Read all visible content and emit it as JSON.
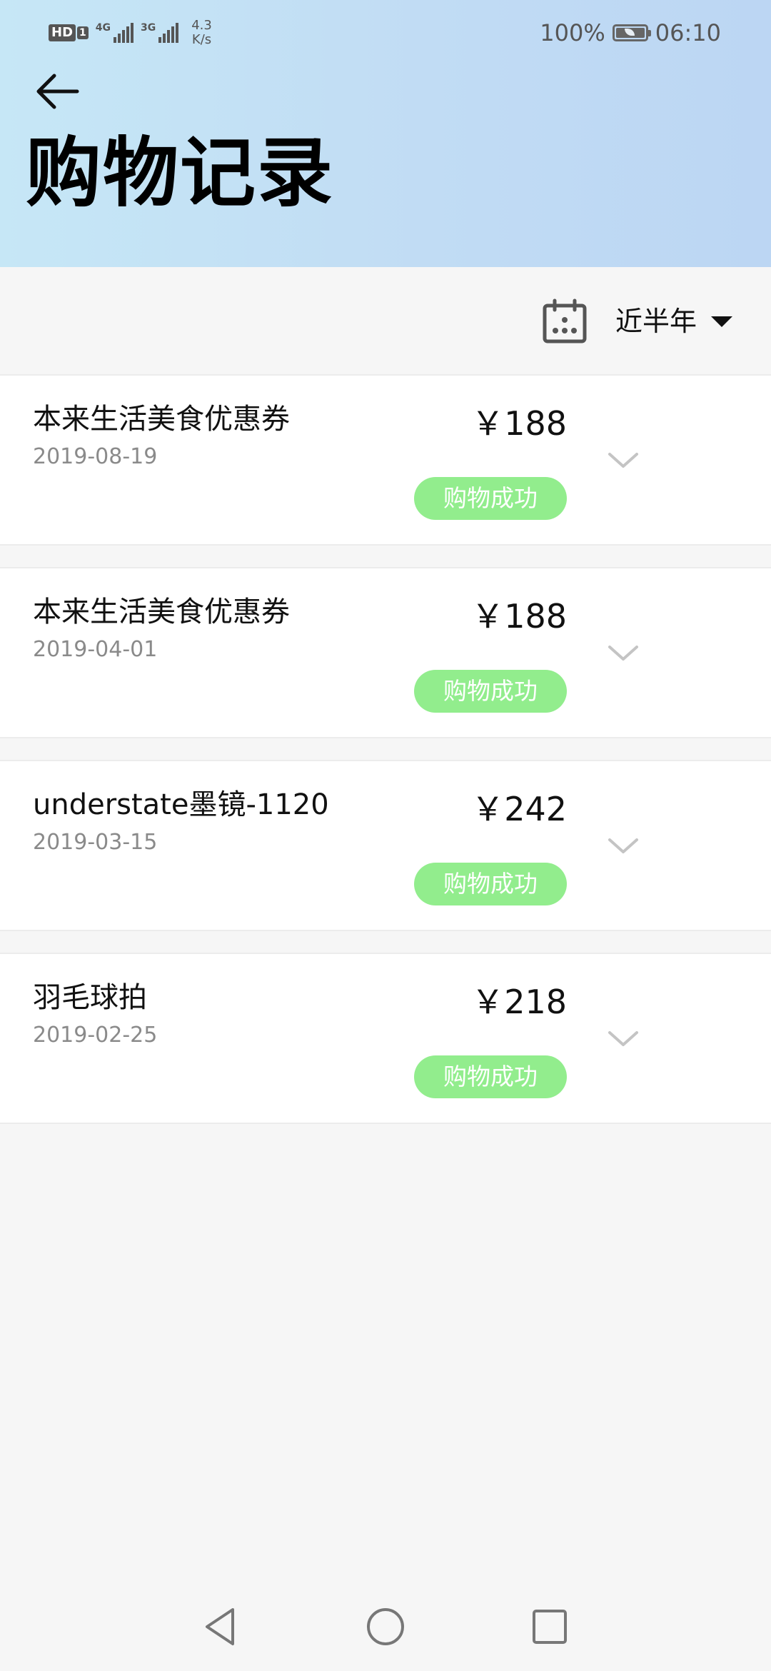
{
  "status_bar": {
    "hd_label": "HD",
    "sim_label": "1",
    "signal1_label": "4G",
    "signal2_label": "3G",
    "net_speed_value": "4.3",
    "net_speed_unit": "K/s",
    "battery_percent": "100%",
    "time": "06:10",
    "icons": [
      "hd-icon",
      "signal-4g-icon",
      "signal-3g-icon",
      "battery-icon"
    ]
  },
  "header": {
    "title": "购物记录",
    "back_icon": "arrow-left-icon"
  },
  "filter": {
    "calendar_icon": "calendar-icon",
    "period_label": "近半年",
    "dropdown_icon": "caret-down-icon"
  },
  "records": [
    {
      "name": "本来生活美食优惠券",
      "date": "2019-08-19",
      "price": "￥188",
      "status": "购物成功"
    },
    {
      "name": "本来生活美食优惠券",
      "date": "2019-04-01",
      "price": "￥188",
      "status": "购物成功"
    },
    {
      "name": "understate墨镜-1120",
      "date": "2019-03-15",
      "price": "￥242",
      "status": "购物成功"
    },
    {
      "name": "羽毛球拍",
      "date": "2019-02-25",
      "price": "￥218",
      "status": "购物成功"
    }
  ],
  "nav_bar": {
    "back_icon": "triangle-back-icon",
    "home_icon": "circle-home-icon",
    "recents_icon": "square-recents-icon"
  },
  "colors": {
    "header_gradient_start": "#c6e7f6",
    "header_gradient_end": "#bcd6f3",
    "status_badge": "#92ed8d",
    "background": "#f6f6f6",
    "date_text": "#8a8a8a"
  }
}
